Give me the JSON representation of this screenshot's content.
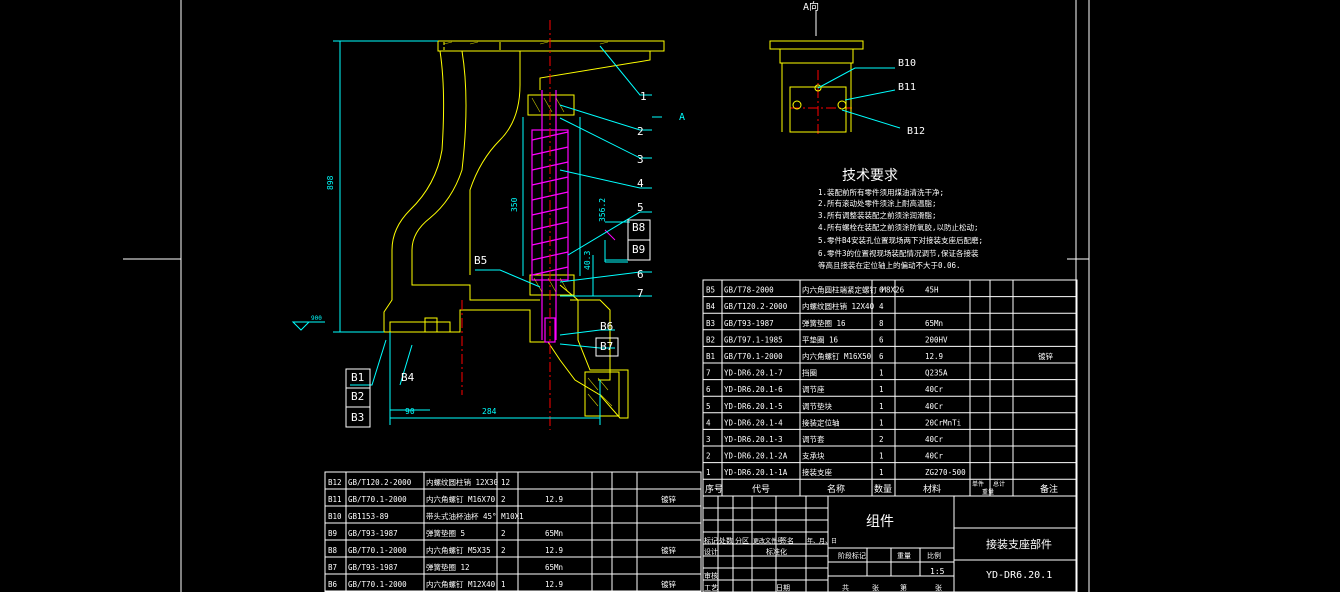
{
  "view_label": "A向",
  "section_marker": "A",
  "dims": {
    "d898": "898",
    "d350": "350",
    "d356": "356.2",
    "d403": "40.3",
    "d90": "90",
    "d284": "284"
  },
  "datum_label": "900",
  "balloons": [
    "1",
    "2",
    "3",
    "4",
    "5",
    "6",
    "7"
  ],
  "balloons_b_main": [
    "B8",
    "B9",
    "B5",
    "B6",
    "B7",
    "B1",
    "B2",
    "B3",
    "B4"
  ],
  "balloons_b_view": [
    "B10",
    "B11",
    "B12"
  ],
  "tech": {
    "title": "技术要求",
    "lines": [
      "1.装配前所有零件须用煤油清洗干净;",
      "2.所有滚动处零件须涂上耐高温脂;",
      "3.所有调整装装配之前须涂润滑脂;",
      "4.所有螺栓在装配之前须涂防氧胶,以防止松动;",
      "5.零件B4安装孔位置现场两下对接装支座后配磨;",
      "6.零件3的位置视现场装配情况调节,保证各接装",
      "  等高且接装在定位轴上的偏动不大于0.06."
    ]
  },
  "bom_upper": [
    [
      "B5",
      "GB/T78-2000",
      "内六角圆柱端紧定螺钉 M8X26",
      "6",
      "45H",
      ""
    ],
    [
      "B4",
      "GB/T120.2-2000",
      "内螺纹圆柱销 12X40",
      "4",
      "",
      ""
    ],
    [
      "B3",
      "GB/T93-1987",
      "弹簧垫圈 16",
      "8",
      "65Mn",
      ""
    ],
    [
      "B2",
      "GB/T97.1-1985",
      "平垫圈 16",
      "6",
      "200HV",
      ""
    ],
    [
      "B1",
      "GB/T70.1-2000",
      "内六角螺钉 M16X50",
      "6",
      "12.9",
      "镀锌"
    ],
    [
      "7",
      "YD-DR6.20.1-7",
      "挡圈",
      "1",
      "Q235A",
      ""
    ],
    [
      "6",
      "YD-DR6.20.1-6",
      "调节座",
      "1",
      "40Cr",
      ""
    ],
    [
      "5",
      "YD-DR6.20.1-5",
      "调节垫块",
      "1",
      "40Cr",
      ""
    ],
    [
      "4",
      "YD-DR6.20.1-4",
      "接装定位轴",
      "1",
      "20CrMnTi",
      ""
    ],
    [
      "3",
      "YD-DR6.20.1-3",
      "调节套",
      "2",
      "40Cr",
      ""
    ],
    [
      "2",
      "YD-DR6.20.1-2A",
      "支承块",
      "1",
      "40Cr",
      ""
    ],
    [
      "1",
      "YD-DR6.20.1-1A",
      "接装支座",
      "1",
      "ZG270-500",
      ""
    ]
  ],
  "bom_header": {
    "no": "序号",
    "code": "代号",
    "name": "名称",
    "qty": "数量",
    "mat": "材料",
    "single": "单件",
    "total": "总计",
    "weight": "重量",
    "remark": "备注"
  },
  "bom_lower": [
    [
      "B12",
      "GB/T120.2-2000",
      "内螺纹圆柱销 12X30",
      "12",
      "",
      ""
    ],
    [
      "B11",
      "GB/T70.1-2000",
      "内六角螺钉 M16X70",
      "2",
      "12.9",
      "镀锌"
    ],
    [
      "B10",
      "GB1153-89",
      "带头式油杯油杯 45° M10X1",
      "",
      "",
      ""
    ],
    [
      "B9",
      "GB/T93-1987",
      "弹簧垫圈 5",
      "2",
      "65Mn",
      ""
    ],
    [
      "B8",
      "GB/T70.1-2000",
      "内六角螺钉 M5X35",
      "2",
      "12.9",
      "镀锌"
    ],
    [
      "B7",
      "GB/T93-1987",
      "弹簧垫圈 12",
      "",
      "65Mn",
      ""
    ],
    [
      "B6",
      "GB/T70.1-2000",
      "内六角螺钉 M12X40",
      "1",
      "12.9",
      "镀锌"
    ]
  ],
  "title_block": {
    "group_label": "组件",
    "drawing_name": "接装支座部件",
    "drawing_no": "YD-DR6.20.1",
    "scale": "1:5",
    "labels": [
      "标记",
      "处数",
      "分区",
      "更改文件号",
      "签名",
      "年、月、日",
      "设计",
      "标准化",
      "审核",
      "工艺",
      "日期",
      "阶段标记",
      "重量",
      "比例",
      "共",
      "张",
      "第",
      "张"
    ]
  },
  "colors": {
    "frame": "#ffffff",
    "outline": "#ffff00",
    "dims": "#00ffff",
    "hatch": "#ff00ff",
    "center": "#ff0000",
    "accent": "#00ff00"
  }
}
